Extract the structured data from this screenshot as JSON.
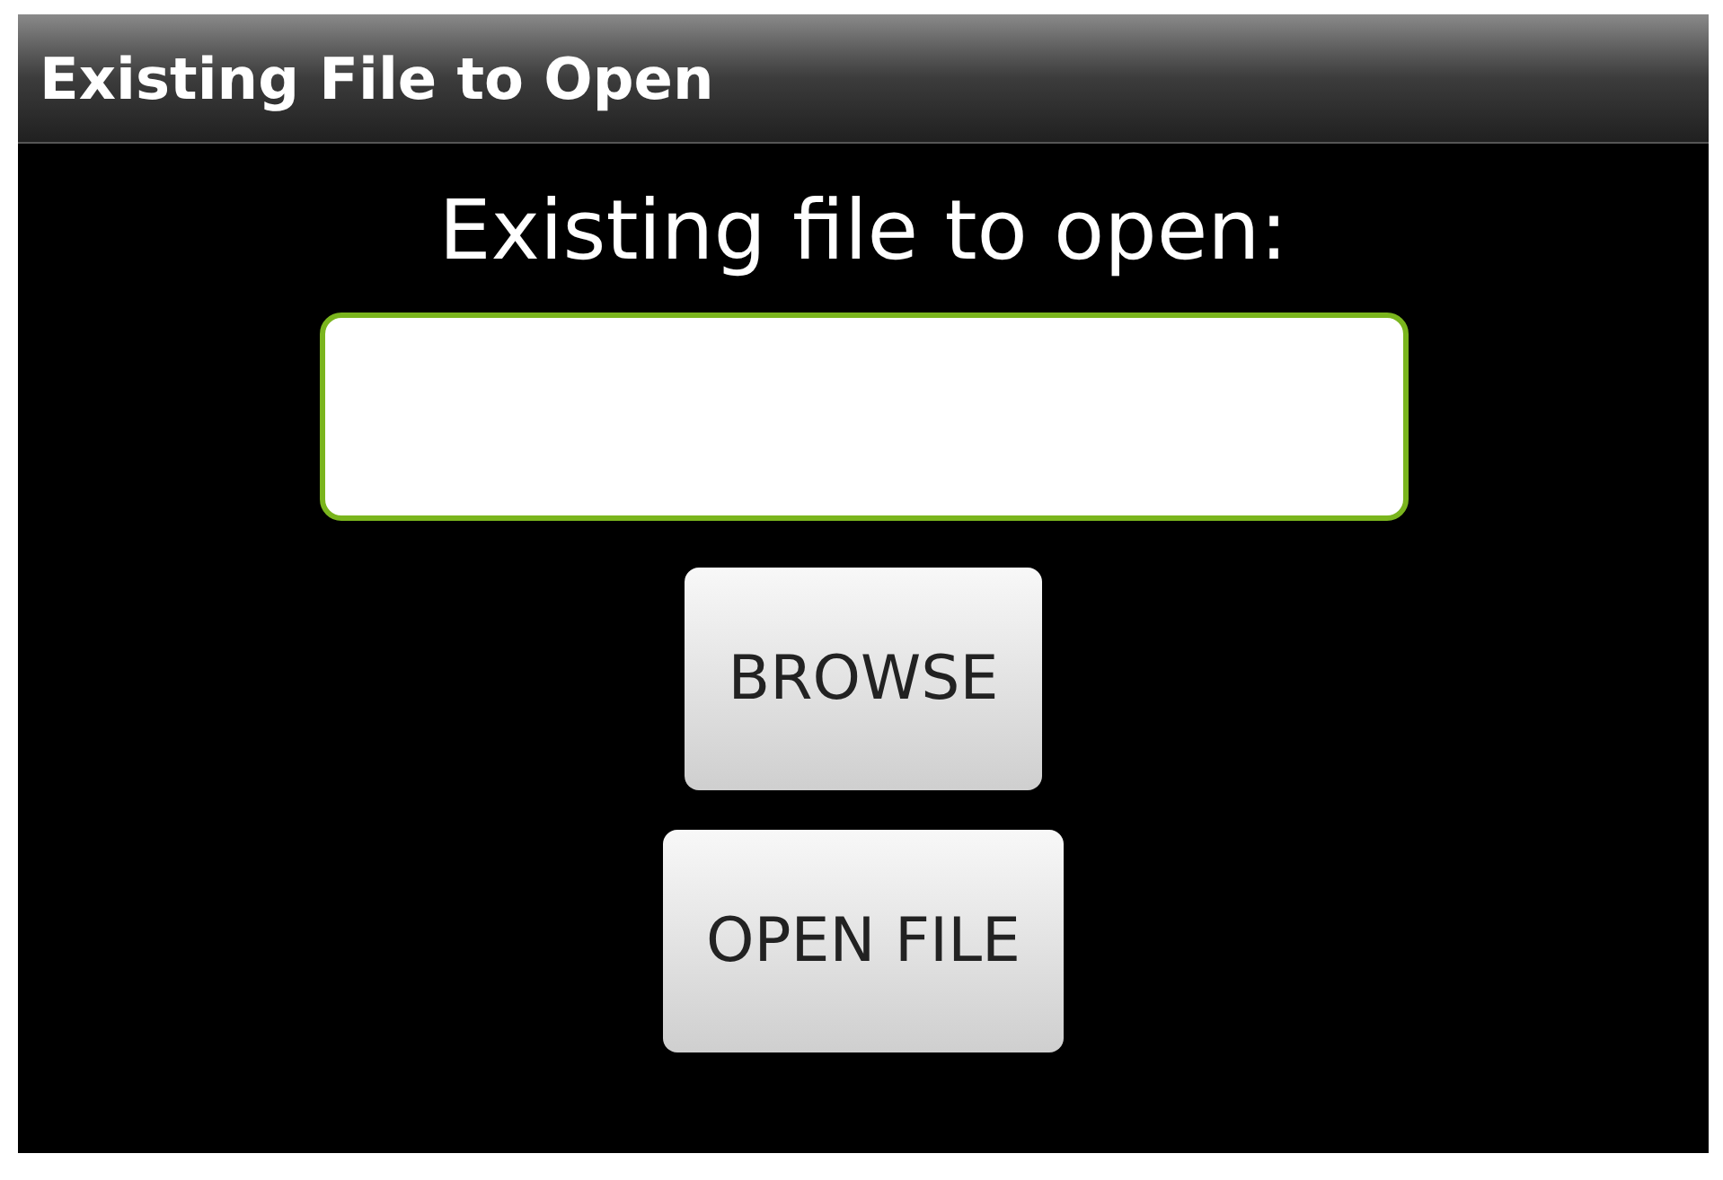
{
  "window": {
    "title": "Existing File to Open"
  },
  "label": "Existing file to open:",
  "file_field": {
    "focused": true
  },
  "buttons": [
    "BROWSE",
    "OPEN FILE"
  ]
}
